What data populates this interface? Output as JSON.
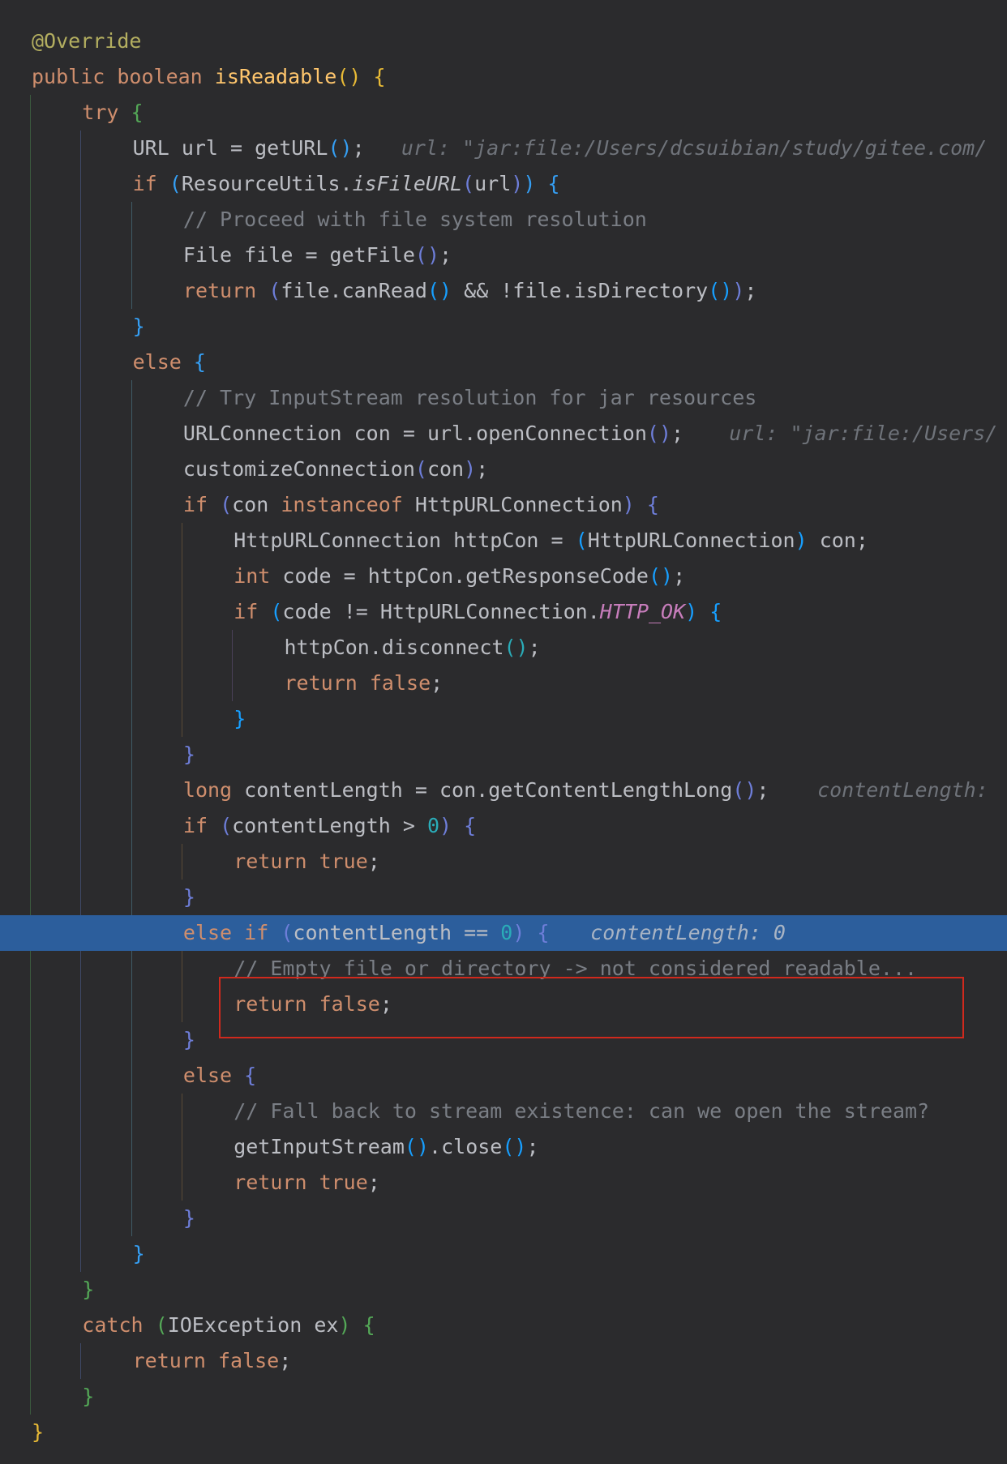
{
  "editor": {
    "language": "Java",
    "current_line": 25,
    "colors": {
      "background": "#2b2b2d",
      "current_line": "#2c5e9c",
      "keyword": "#cf8e6d",
      "annotation": "#b3ae60",
      "comment": "#7a7e85",
      "number": "#2aacb8",
      "constant": "#c77dbb",
      "selection_outline": "#d0291d"
    },
    "lines": [
      {
        "text": "@Override",
        "indent": 0
      },
      {
        "text": "public boolean isReadable() {",
        "indent": 0
      },
      {
        "text": "try {",
        "indent": 1
      },
      {
        "text": "URL url = getURL();",
        "indent": 2,
        "hint": "url: \"jar:file:/Users/dcsuibian/study/gitee.com/"
      },
      {
        "text": "if (ResourceUtils.isFileURL(url)) {",
        "indent": 2
      },
      {
        "text": "// Proceed with file system resolution",
        "indent": 3
      },
      {
        "text": "File file = getFile();",
        "indent": 3
      },
      {
        "text": "return (file.canRead() && !file.isDirectory());",
        "indent": 3
      },
      {
        "text": "}",
        "indent": 2
      },
      {
        "text": "else {",
        "indent": 2
      },
      {
        "text": "// Try InputStream resolution for jar resources",
        "indent": 3
      },
      {
        "text": "URLConnection con = url.openConnection();",
        "indent": 3,
        "hint": "url: \"jar:file:/Users/"
      },
      {
        "text": "customizeConnection(con);",
        "indent": 3
      },
      {
        "text": "if (con instanceof HttpURLConnection) {",
        "indent": 3
      },
      {
        "text": "HttpURLConnection httpCon = (HttpURLConnection) con;",
        "indent": 4
      },
      {
        "text": "int code = httpCon.getResponseCode();",
        "indent": 4
      },
      {
        "text": "if (code != HttpURLConnection.HTTP_OK) {",
        "indent": 4
      },
      {
        "text": "httpCon.disconnect();",
        "indent": 5
      },
      {
        "text": "return false;",
        "indent": 5
      },
      {
        "text": "}",
        "indent": 4
      },
      {
        "text": "}",
        "indent": 3
      },
      {
        "text": "long contentLength = con.getContentLengthLong();",
        "indent": 3,
        "hint": "contentLength:"
      },
      {
        "text": "if (contentLength > 0) {",
        "indent": 3
      },
      {
        "text": "return true;",
        "indent": 4
      },
      {
        "text": "}",
        "indent": 3
      },
      {
        "text": "else if (contentLength == 0) {",
        "indent": 3,
        "hint": "contentLength: 0"
      },
      {
        "text": "// Empty file or directory -> not considered readable...",
        "indent": 4
      },
      {
        "text": "return false;",
        "indent": 4
      },
      {
        "text": "}",
        "indent": 3
      },
      {
        "text": "else {",
        "indent": 3
      },
      {
        "text": "// Fall back to stream existence: can we open the stream?",
        "indent": 4
      },
      {
        "text": "getInputStream().close();",
        "indent": 4
      },
      {
        "text": "return true;",
        "indent": 4
      },
      {
        "text": "}",
        "indent": 3
      },
      {
        "text": "}",
        "indent": 2
      },
      {
        "text": "}",
        "indent": 1
      },
      {
        "text": "catch (IOException ex) {",
        "indent": 1
      },
      {
        "text": "return false;",
        "indent": 2
      },
      {
        "text": "}",
        "indent": 1
      },
      {
        "text": "}",
        "indent": 0
      }
    ]
  }
}
